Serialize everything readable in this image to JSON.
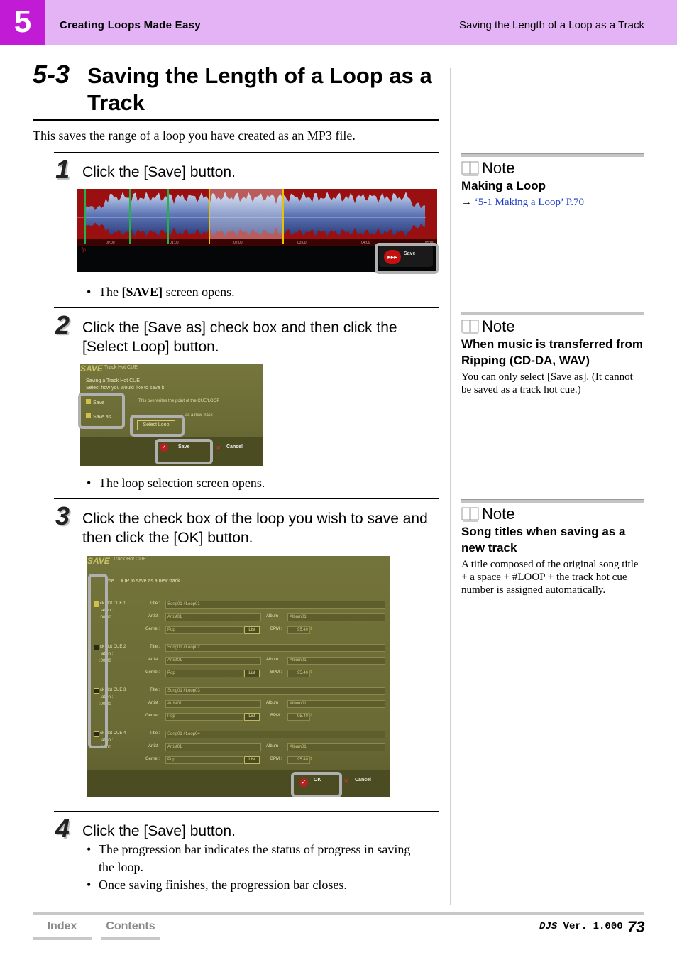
{
  "header": {
    "chapter": "5",
    "left": "Creating Loops Made Easy",
    "right": "Saving the Length of a Loop as a Track"
  },
  "section": {
    "number": "5-3",
    "title": "Saving the Length of a Loop as a Track"
  },
  "intro": "This saves the range of a loop you have created as an MP3 file.",
  "steps": [
    {
      "num": "1",
      "text": "Click the [Save] button.",
      "bullets": [
        "The [SAVE] screen opens."
      ]
    },
    {
      "num": "2",
      "text": "Click the [Save as] check box and then click the [Select Loop] button.",
      "bullets": [
        "The loop selection screen opens."
      ]
    },
    {
      "num": "3",
      "text": "Click the check box of the loop you wish to save and then click the [OK] button.",
      "bullets": []
    },
    {
      "num": "4",
      "text": "Click the [Save] button.",
      "bullets": [
        "The progression bar indicates the status of progress in saving the loop.",
        "Once saving finishes, the progression bar closes."
      ]
    }
  ],
  "step1_bullet": {
    "pre": "The ",
    "bold": "[SAVE]",
    "post": " screen opens."
  },
  "notes": [
    {
      "label": "Note",
      "title": "Making a Loop",
      "body_arrow": "→",
      "body_link": "‘5-1 Making a Loop’ P.70"
    },
    {
      "label": "Note",
      "title": "When music is transferred from Ripping (CD-DA, WAV)",
      "body": "You can only select [Save as]. (It cannot be saved as a track hot cue.)"
    },
    {
      "label": "Note",
      "title": "Song titles when saving as a new track",
      "body": "A title composed of the original song title + a space + #LOOP + the track hot cue number is assigned automatically."
    }
  ],
  "shot1": {
    "save_btn": "Save",
    "times": [
      "00:00",
      "01:00",
      "02:00",
      "03:00",
      "04:00",
      "05:00"
    ]
  },
  "shot2": {
    "logo": "SAVE",
    "tab": "Track Hot CUE",
    "line1": "Saving a Track Hot CUE",
    "line2": "Select how you would like to save it",
    "opt_save": "Save",
    "opt_save_as": "Save as",
    "desc1": "This overwrites the point of the CUE/LOOP",
    "desc2": "as a new track",
    "select_loop": "Select Loop",
    "save": "Save",
    "cancel": "Cancel"
  },
  "shot3": {
    "logo": "SAVE",
    "tab": "Track Hot CUE",
    "instruction": "the LOOP to save as a new track",
    "rows": [
      {
        "cue": "ck Hot CUE 1",
        "dur_label": "ation :",
        "dur": ":00.00",
        "title": "Song01 #Loop01",
        "artist": "Artist01",
        "album": "Album01",
        "genre": "Pop",
        "bpm": "95.40",
        "checked": true
      },
      {
        "cue": "ck Hot CUE 2",
        "dur_label": "ation :",
        "dur": ":00.00",
        "title": "Song01 #Loop02",
        "artist": "Artist01",
        "album": "Album01",
        "genre": "Pop",
        "bpm": "95.40",
        "checked": false
      },
      {
        "cue": "ck Hot CUE 3",
        "dur_label": "ation :",
        "dur": ":00.00",
        "title": "Song01 #Loop03",
        "artist": "Artist01",
        "album": "Album01",
        "genre": "Pop",
        "bpm": "95.40",
        "checked": false
      },
      {
        "cue": "ck Hot CUE 4",
        "dur_label": "ation :",
        "dur": ":00.00",
        "title": "Song01 #Loop04",
        "artist": "Artist01",
        "album": "Album01",
        "genre": "Pop",
        "bpm": "95.40",
        "checked": false
      }
    ],
    "labels": {
      "title": "Title :",
      "artist": "Artist :",
      "album": "Album :",
      "genre": "Genre :",
      "bpm": "BPM :",
      "list": "List"
    },
    "ok": "OK",
    "cancel": "Cancel"
  },
  "footer": {
    "index": "Index",
    "contents": "Contents",
    "product": "DJS",
    "version": " Ver. 1.000",
    "page": "73"
  }
}
